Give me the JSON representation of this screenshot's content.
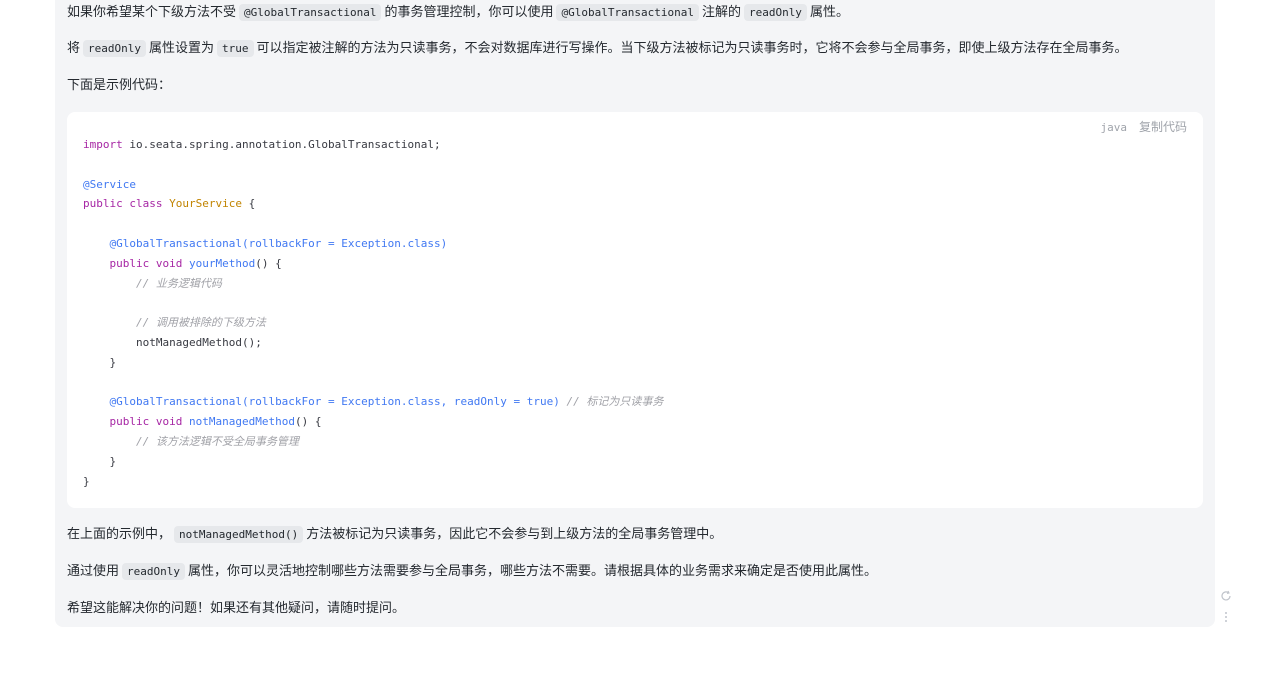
{
  "p1": {
    "t1": "如果你希望某个下级方法不受",
    "c1": "@GlobalTransactional",
    "t2": "的事务管理控制，你可以使用",
    "c2": "@GlobalTransactional",
    "t3": "注解的",
    "c3": "readOnly",
    "t4": "属性。"
  },
  "p2": {
    "t1": "将",
    "c1": "readOnly",
    "t2": "属性设置为",
    "c2": "true",
    "t3": "可以指定被注解的方法为只读事务，不会对数据库进行写操作。当下级方法被标记为只读事务时，它将不会参与全局事务，即使上级方法存在全局事务。"
  },
  "p3": "下面是示例代码：",
  "code_block": {
    "language": "java",
    "copy_label": "复制代码",
    "l1_kw": "import",
    "l1_rest": " io.seata.spring.annotation.GlobalTransactional;",
    "l3_ann": "@Service",
    "l4_kw": "public class",
    "l4_cls": "YourService",
    "l4_rest": " {",
    "l6_ann": "@GlobalTransactional(rollbackFor = Exception.class)",
    "l7_kw": "public void",
    "l7_fn": "yourMethod",
    "l7_rest": "() {",
    "l8_cm": "// 业务逻辑代码",
    "l10_cm": "// 调用被排除的下级方法",
    "l11": "notManagedMethod();",
    "l12": "}",
    "l14_ann": "@GlobalTransactional(rollbackFor = Exception.class, readOnly = true)",
    "l14_cm": "// 标记为只读事务",
    "l15_kw": "public void",
    "l15_fn": "notManagedMethod",
    "l15_rest": "() {",
    "l16_cm": "// 该方法逻辑不受全局事务管理",
    "l17": "}",
    "l18": "}"
  },
  "p4": {
    "t1": "在上面的示例中，",
    "c1": "notManagedMethod()",
    "t2": "方法被标记为只读事务，因此它不会参与到上级方法的全局事务管理中。"
  },
  "p5": {
    "t1": "通过使用",
    "c1": "readOnly",
    "t2": "属性，你可以灵活地控制哪些方法需要参与全局事务，哪些方法不需要。请根据具体的业务需求来确定是否使用此属性。"
  },
  "p6": "希望这能解决你的问题！如果还有其他疑问，请随时提问。",
  "side_icons": [
    "refresh-icon",
    "more-vertical-icon"
  ],
  "colors": {
    "message_bg": "#f4f5f7",
    "code_bg": "#ffffff",
    "inline_code_bg": "#e6e8eb",
    "keyword": "#a626a4",
    "function": "#4078f2",
    "class": "#c18401",
    "comment": "#a0a1a7"
  }
}
